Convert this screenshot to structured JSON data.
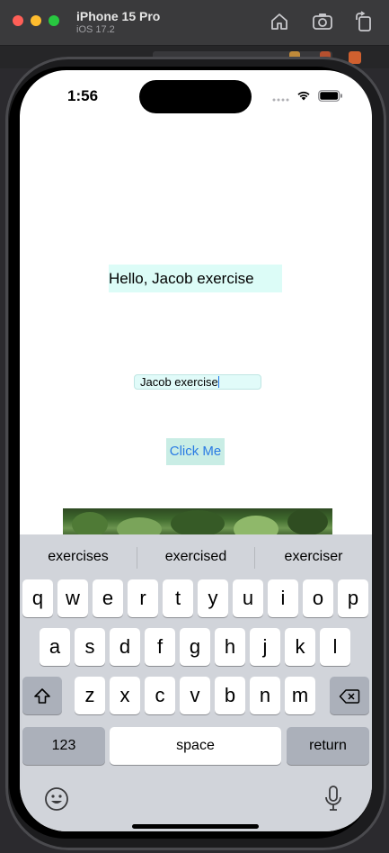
{
  "simulator": {
    "device_name": "iPhone 15 Pro",
    "os_version": "iOS 17.2",
    "traffic_lights": {
      "close": "#ff5f57",
      "minimize": "#febc2e",
      "zoom": "#28c840"
    },
    "toolbar_icons": [
      "home-icon",
      "screenshot-icon",
      "rotate-icon"
    ]
  },
  "status_bar": {
    "time": "1:56",
    "icons": [
      "signal-dots-icon",
      "wifi-icon",
      "battery-icon"
    ]
  },
  "app": {
    "greeting": "Hello, Jacob exercise",
    "name_field_value": "Jacob exercise",
    "button_label": "Click Me",
    "accent_color": "#2a7be4",
    "background_tint": "#dcfcf7"
  },
  "keyboard": {
    "suggestions": [
      "exercises",
      "exercised",
      "exerciser"
    ],
    "rows": [
      [
        "q",
        "w",
        "e",
        "r",
        "t",
        "y",
        "u",
        "i",
        "o",
        "p"
      ],
      [
        "a",
        "s",
        "d",
        "f",
        "g",
        "h",
        "j",
        "k",
        "l"
      ],
      [
        "z",
        "x",
        "c",
        "v",
        "b",
        "n",
        "m"
      ]
    ],
    "shift_icon": "shift-icon",
    "delete_icon": "delete-icon",
    "numbers_label": "123",
    "space_label": "space",
    "return_label": "return",
    "emoji_icon": "emoji-icon",
    "dictation_icon": "microphone-icon"
  }
}
